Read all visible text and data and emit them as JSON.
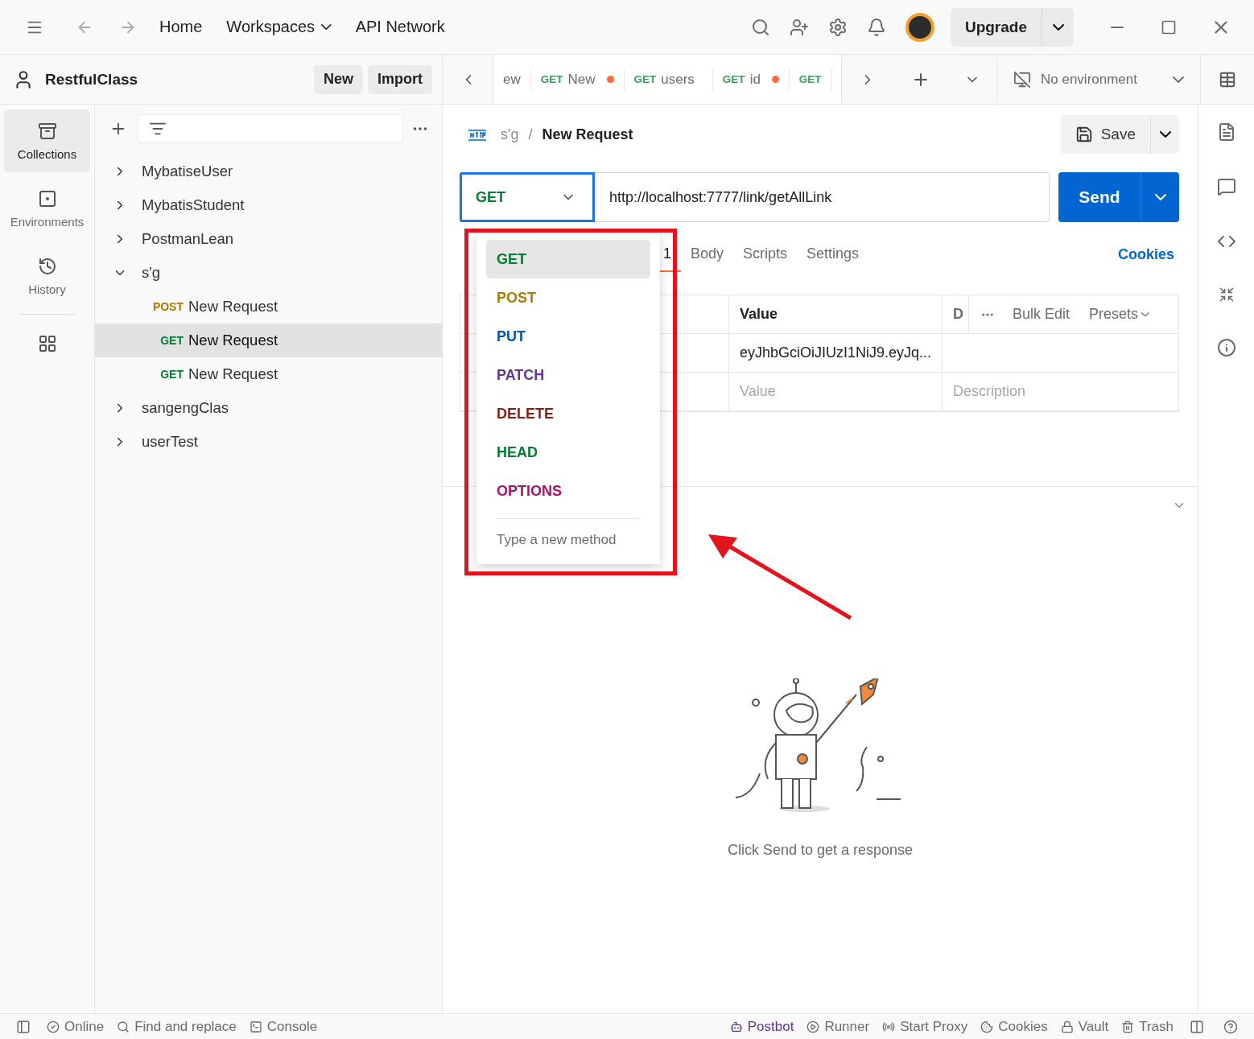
{
  "title_bar": {
    "nav": [
      {
        "label": "Home",
        "dropdown": false
      },
      {
        "label": "Workspaces",
        "dropdown": true
      },
      {
        "label": "API Network",
        "dropdown": false
      }
    ],
    "upgrade": "Upgrade"
  },
  "sidebar": {
    "workspace": "RestfulClass",
    "buttons": [
      "New",
      "Import"
    ],
    "rail": [
      {
        "label": "Collections",
        "selected": true
      },
      {
        "label": "Environments",
        "selected": false
      },
      {
        "label": "History",
        "selected": false
      }
    ],
    "tree": [
      {
        "name": "MybatiseUser",
        "expanded": false
      },
      {
        "name": "MybatisStudent",
        "expanded": false
      },
      {
        "name": "PostmanLean",
        "expanded": false
      },
      {
        "name": "s'g",
        "expanded": true,
        "children": [
          {
            "method": "POST",
            "color": "#ad7a03",
            "name": "New Request",
            "selected": false
          },
          {
            "method": "GET",
            "color": "#007f31",
            "name": "New Request",
            "selected": true
          },
          {
            "method": "GET",
            "color": "#007f31",
            "name": "New Request",
            "selected": false
          }
        ]
      },
      {
        "name": "sangengClas",
        "expanded": false
      },
      {
        "name": "userTest",
        "expanded": false
      }
    ]
  },
  "tabs": [
    {
      "label": "ew",
      "unsaved": false
    },
    {
      "method": "GET",
      "color": "#3a9c5c",
      "label": "New",
      "unsaved": true
    },
    {
      "method": "GET",
      "color": "#3a9c5c",
      "label": "users",
      "unsaved": false
    },
    {
      "method": "GET",
      "color": "#3a9c5c",
      "label": "id",
      "unsaved": true
    },
    {
      "method": "GET",
      "color": "#3a9c5c",
      "unsaved": false
    }
  ],
  "environment": "No environment",
  "request": {
    "breadcrumb": {
      "collection": "s'g",
      "separator": "/",
      "name": "New Request"
    },
    "save": "Save",
    "method": "GET",
    "url": "http://localhost:7777/link/getAllLink",
    "send": "Send",
    "tabs": [
      {
        "label": "1",
        "selected": true
      },
      {
        "label": "Body",
        "selected": false
      },
      {
        "label": "Scripts",
        "selected": false
      },
      {
        "label": "Settings",
        "selected": false
      }
    ],
    "cookies": "Cookies",
    "table": {
      "columns": [
        "Value",
        "D"
      ],
      "actions": [
        "Bulk Edit",
        "Presets"
      ],
      "rows": [
        {
          "value": "eyJhbGciOiJIUzI1NiJ9.eyJq..."
        }
      ],
      "placeholders": {
        "value": "Value",
        "description": "Description"
      }
    }
  },
  "method_menu": {
    "items": [
      {
        "label": "GET",
        "color": "#007f31",
        "selected": true
      },
      {
        "label": "POST",
        "color": "#ad7a03",
        "selected": false
      },
      {
        "label": "PUT",
        "color": "#0053b8",
        "selected": false
      },
      {
        "label": "PATCH",
        "color": "#623497",
        "selected": false
      },
      {
        "label": "DELETE",
        "color": "#8e1a10",
        "selected": false
      },
      {
        "label": "HEAD",
        "color": "#007f31",
        "selected": false
      },
      {
        "label": "OPTIONS",
        "color": "#a61468",
        "selected": false
      }
    ],
    "placeholder": "Type a new method"
  },
  "response": {
    "hint": "Click Send to get a response"
  },
  "status_bar": {
    "left": [
      {
        "kind": "online",
        "label": "Online"
      },
      {
        "kind": "find",
        "label": "Find and replace"
      },
      {
        "kind": "console",
        "label": "Console"
      }
    ],
    "right": [
      {
        "kind": "postbot",
        "label": "Postbot"
      },
      {
        "kind": "runner",
        "label": "Runner"
      },
      {
        "kind": "proxy",
        "label": "Start Proxy"
      },
      {
        "kind": "cookies",
        "label": "Cookies"
      },
      {
        "kind": "vault",
        "label": "Vault"
      },
      {
        "kind": "trash",
        "label": "Trash"
      }
    ]
  }
}
